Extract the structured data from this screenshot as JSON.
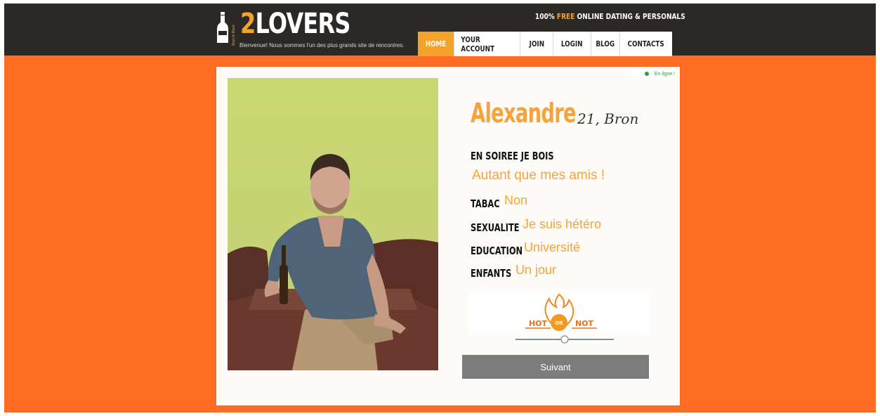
{
  "brand": {
    "name_prefix": "2",
    "name_rest": "LOVERS",
    "tiny_text": "Boys in Black",
    "tagline": "Bienvenue! Nous sommes l'un des plus grands site de rencontres."
  },
  "topline": {
    "prefix": "100% ",
    "highlight": "FREE",
    "suffix": " ONLINE DATING & PERSONALS"
  },
  "nav": {
    "home": "HOME",
    "account": "YOUR ACCOUNT",
    "join": "JOIN",
    "login": "LOGIN",
    "blog": "BLOG",
    "contacts": "CONTACTS"
  },
  "status": {
    "online": "En ligne !"
  },
  "profile": {
    "name": "Alexandre",
    "age_city": "21, Bron",
    "fields": {
      "soiree_label": "EN SOIREE JE BOIS",
      "soiree_value": "Autant que mes amis !",
      "tabac_label": "TABAC",
      "tabac_value": "Non",
      "sexualite_label": "SEXUALITE",
      "sexualite_value": "Je suis hétéro",
      "education_label": "EDUCATION",
      "education_value": "Université",
      "enfants_label": "ENFANTS",
      "enfants_value": "Un jour"
    }
  },
  "rating": {
    "hot": "HOT",
    "or": "OR",
    "not": "NOT",
    "slider_value": 0.5
  },
  "actions": {
    "next": "Suivant"
  },
  "colors": {
    "orange": "#ff6d24",
    "accent": "#f4a22a",
    "dark": "#2b2826"
  }
}
